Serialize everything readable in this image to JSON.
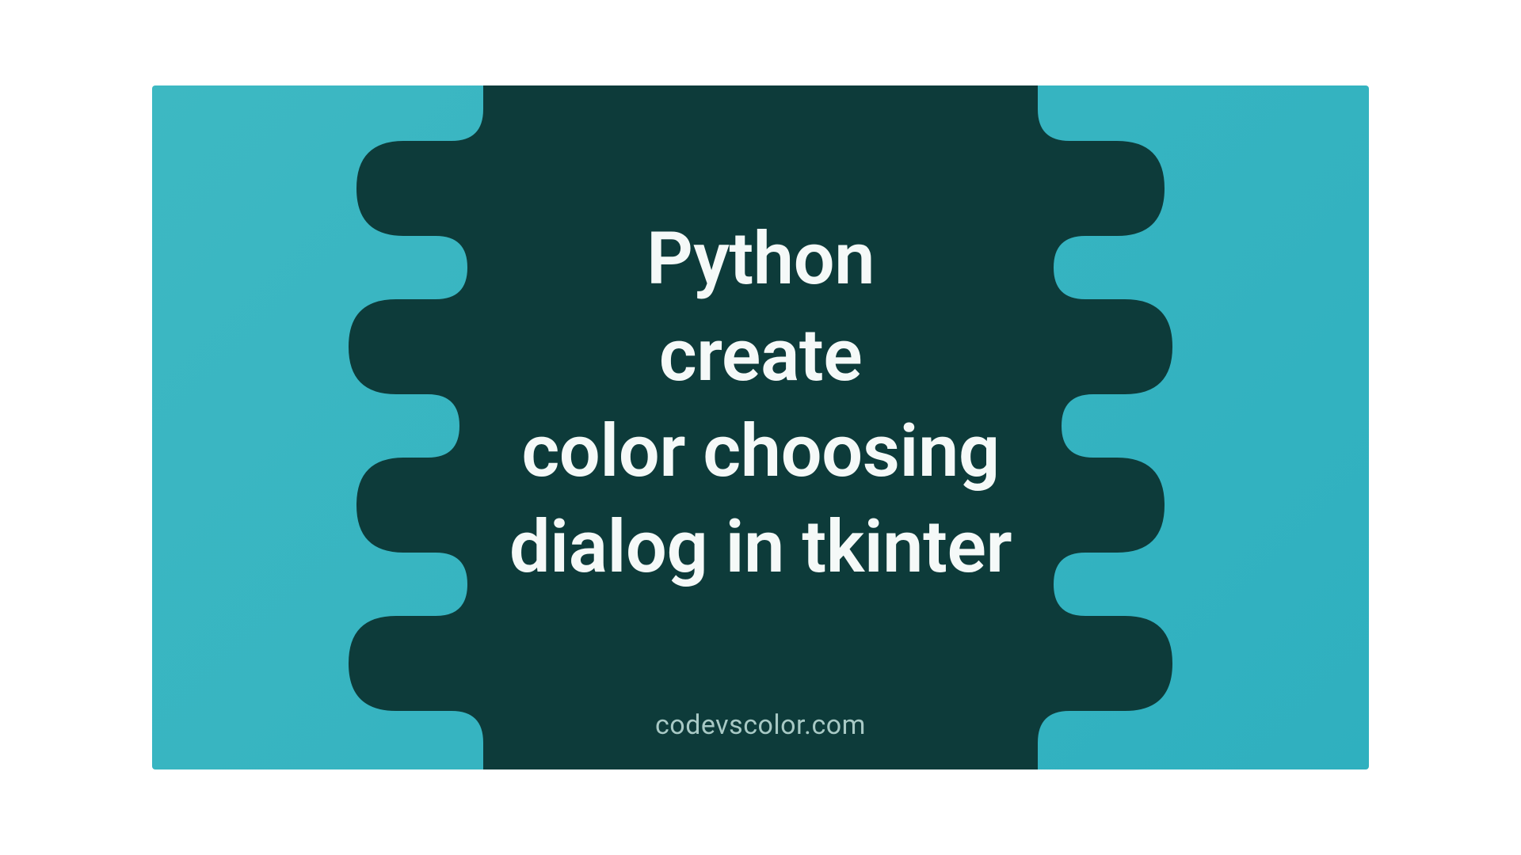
{
  "title": {
    "line1": "Python",
    "line2": "create",
    "line3": "color choosing",
    "line4": "dialog in tkinter"
  },
  "watermark": "codevscolor.com",
  "colors": {
    "bg_light": "#3db8c2",
    "blob_dark": "#0d3b3a",
    "text": "#f5f9f8",
    "watermark": "#a8c9c5"
  }
}
